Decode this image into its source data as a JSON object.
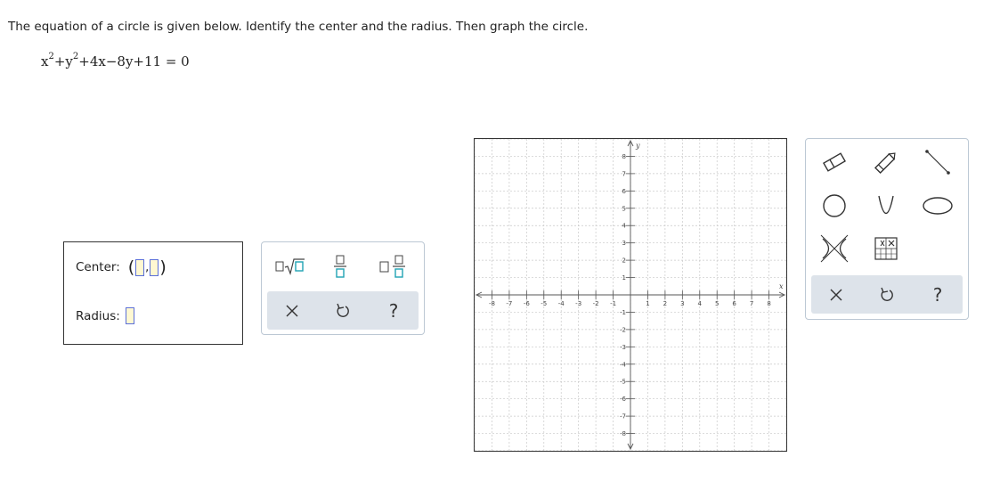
{
  "question": {
    "text": "The equation of a circle is given below. Identify the center and the radius. Then graph the circle."
  },
  "equation": {
    "t1": "x",
    "e1": "2",
    "t2": "+y",
    "e2": "2",
    "t3": "+4x−8y+11 = 0"
  },
  "answer": {
    "center_label": "Center:",
    "radius_label": "Radius:",
    "center_x_value": "",
    "center_y_value": "",
    "radius_value": ""
  },
  "palette": {
    "buttons": [
      "square-root-icon",
      "fraction-icon",
      "mixed-number-icon"
    ],
    "bar": [
      "clear-icon",
      "undo-icon",
      "help-icon"
    ],
    "help_symbol": "?"
  },
  "graph": {
    "x_label": "x",
    "y_label": "y",
    "x_ticks": [
      "-8",
      "-7",
      "-6",
      "-5",
      "-4",
      "-3",
      "-2",
      "-1",
      "1",
      "2",
      "3",
      "4",
      "5",
      "6",
      "7",
      "8"
    ],
    "y_ticks": [
      "8",
      "7",
      "6",
      "5",
      "4",
      "3",
      "2",
      "1",
      "-1",
      "-2",
      "-3",
      "-4",
      "-5",
      "-6",
      "-7",
      "-8"
    ],
    "range": [
      -9,
      9
    ]
  },
  "tools": {
    "items": [
      "eraser-icon",
      "pencil-icon",
      "line-segment-icon",
      "circle-icon",
      "parabola-icon",
      "ellipse-icon",
      "hyperbola-icon",
      "table-tool-icon"
    ],
    "bar": [
      "clear-icon",
      "undo-icon",
      "help-icon"
    ],
    "help_symbol": "?"
  },
  "colors": {
    "input_border": "#5b6fd8",
    "input_fill": "#fff8d2",
    "palette_bar": "#dde3ea",
    "grid_line": "#c8c8c8",
    "teal": "#1fa3b3"
  }
}
